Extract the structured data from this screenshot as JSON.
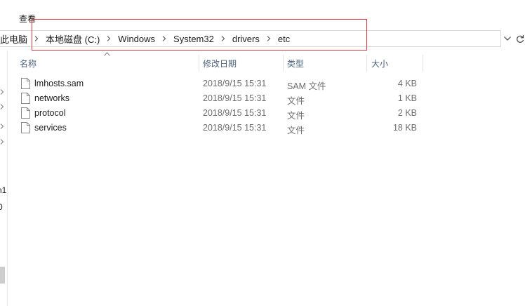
{
  "ribbon": {
    "tab_view": "查看"
  },
  "address": {
    "crumbs": [
      "此电脑",
      "本地磁盘 (C:)",
      "Windows",
      "System32",
      "drivers",
      "etc"
    ]
  },
  "nav": {
    "frag_1": "n1",
    "frag_2": "0"
  },
  "columns": {
    "name": "名称",
    "date": "修改日期",
    "type": "类型",
    "size": "大小"
  },
  "files": [
    {
      "name": "lmhosts.sam",
      "date": "2018/9/15 15:31",
      "type": "SAM 文件",
      "size": "4 KB"
    },
    {
      "name": "networks",
      "date": "2018/9/15 15:31",
      "type": "文件",
      "size": "1 KB"
    },
    {
      "name": "protocol",
      "date": "2018/9/15 15:31",
      "type": "文件",
      "size": "2 KB"
    },
    {
      "name": "services",
      "date": "2018/9/15 15:31",
      "type": "文件",
      "size": "18 KB"
    }
  ],
  "icons": {
    "file": "file-icon",
    "separator": "chevron-right-icon",
    "dropdown": "chevron-down-icon",
    "refresh": "refresh-icon",
    "sort": "sort-ascending-icon",
    "nav_expand": "chevron-right-icon"
  },
  "colors": {
    "highlight": "#d9363e",
    "header_text": "#4c607a",
    "secondary_text": "#6d6d6d"
  }
}
